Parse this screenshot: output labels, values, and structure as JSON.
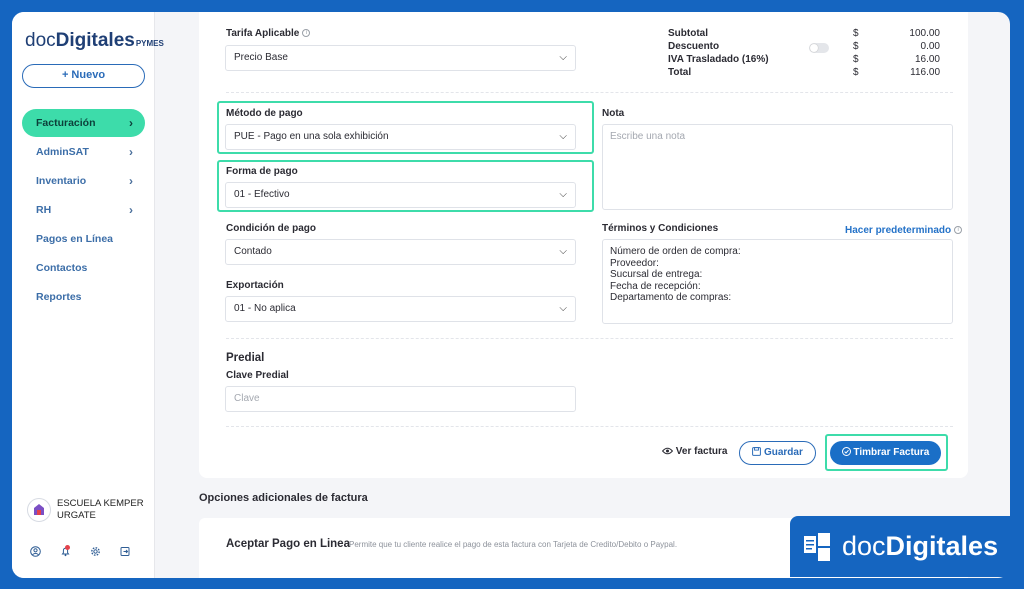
{
  "sidebar": {
    "logo": {
      "part1": "doc",
      "part2": "Digitales",
      "suffix": "PYMES"
    },
    "new_button": "+ Nuevo",
    "items": [
      {
        "label": "Facturación",
        "chevron": true
      },
      {
        "label": "AdminSAT",
        "chevron": true
      },
      {
        "label": "Inventario",
        "chevron": true
      },
      {
        "label": "RH",
        "chevron": true
      },
      {
        "label": "Pagos en Línea",
        "chevron": false
      },
      {
        "label": "Contactos",
        "chevron": false
      },
      {
        "label": "Reportes",
        "chevron": false
      }
    ],
    "company": {
      "line1": "ESCUELA KEMPER",
      "line2": "URGATE"
    },
    "bottom_icons": [
      "user-icon",
      "bell-icon",
      "gear-icon",
      "logout-icon"
    ]
  },
  "form": {
    "tarifa": {
      "label": "Tarifa Aplicable",
      "value": "Precio Base"
    },
    "metodo_pago": {
      "label": "Método de pago",
      "value": "PUE - Pago en una sola exhibición"
    },
    "forma_pago": {
      "label": "Forma de pago",
      "value": "01 - Efectivo"
    },
    "condicion_pago": {
      "label": "Condición de pago",
      "value": "Contado"
    },
    "exportacion": {
      "label": "Exportación",
      "value": "01 - No aplica"
    },
    "nota": {
      "label": "Nota",
      "placeholder": "Escribe una nota"
    },
    "terminos": {
      "label": "Términos y Condiciones",
      "link": "Hacer predeterminado",
      "lines": [
        "Número de orden de compra:",
        "Proveedor:",
        "Sucursal de entrega:",
        "Fecha de recepción:",
        "Departamento de compras:"
      ]
    },
    "predial": {
      "title": "Predial",
      "label": "Clave Predial",
      "placeholder": "Clave"
    }
  },
  "totals": {
    "rows": [
      {
        "label": "Subtotal",
        "currency": "$",
        "value": "100.00"
      },
      {
        "label": "Descuento",
        "currency": "$",
        "value": "0.00"
      },
      {
        "label": "IVA Trasladado (16%)",
        "currency": "$",
        "value": "16.00"
      },
      {
        "label": "Total",
        "currency": "$",
        "value": "116.00"
      }
    ]
  },
  "actions": {
    "ver": "Ver factura",
    "guardar": "Guardar",
    "timbrar": "Timbrar Factura"
  },
  "extra": {
    "section_title": "Opciones adicionales de factura",
    "item_title": "Aceptar Pago en Linea",
    "item_desc": "Permite que tu cliente realice el pago de esta factura con Tarjeta de Credito/Debito o Paypal."
  },
  "brand": {
    "part1": "doc",
    "part2": "Digitales"
  },
  "colors": {
    "accent": "#3ddcaa",
    "primary": "#1a6fc7",
    "background": "#1565c0"
  }
}
